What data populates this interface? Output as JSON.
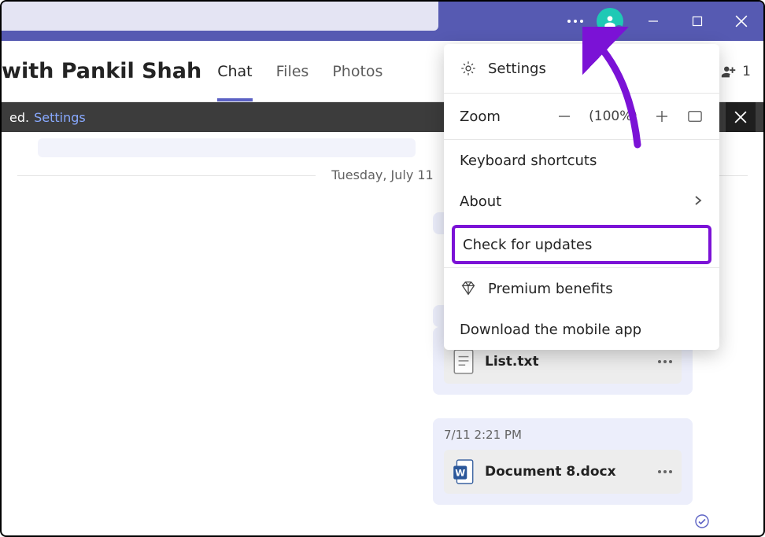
{
  "header": {
    "chat_title": "with Pankil Shah",
    "tabs": {
      "chat": "Chat",
      "files": "Files",
      "photos": "Photos"
    },
    "participants_count": "1"
  },
  "banner": {
    "text_suffix": "ed.",
    "settings_link": "Settings"
  },
  "chat": {
    "date_separator": "Tuesday, July 11",
    "msg2": {
      "file_name": "List.txt"
    },
    "msg3": {
      "timestamp": "7/11 2:21 PM",
      "file_name": "Document 8.docx"
    }
  },
  "menu": {
    "settings": "Settings",
    "zoom_label": "Zoom",
    "zoom_value": "(100%)",
    "keyboard_shortcuts": "Keyboard shortcuts",
    "about": "About",
    "check_updates": "Check for updates",
    "premium": "Premium benefits",
    "download_app": "Download the mobile app"
  }
}
